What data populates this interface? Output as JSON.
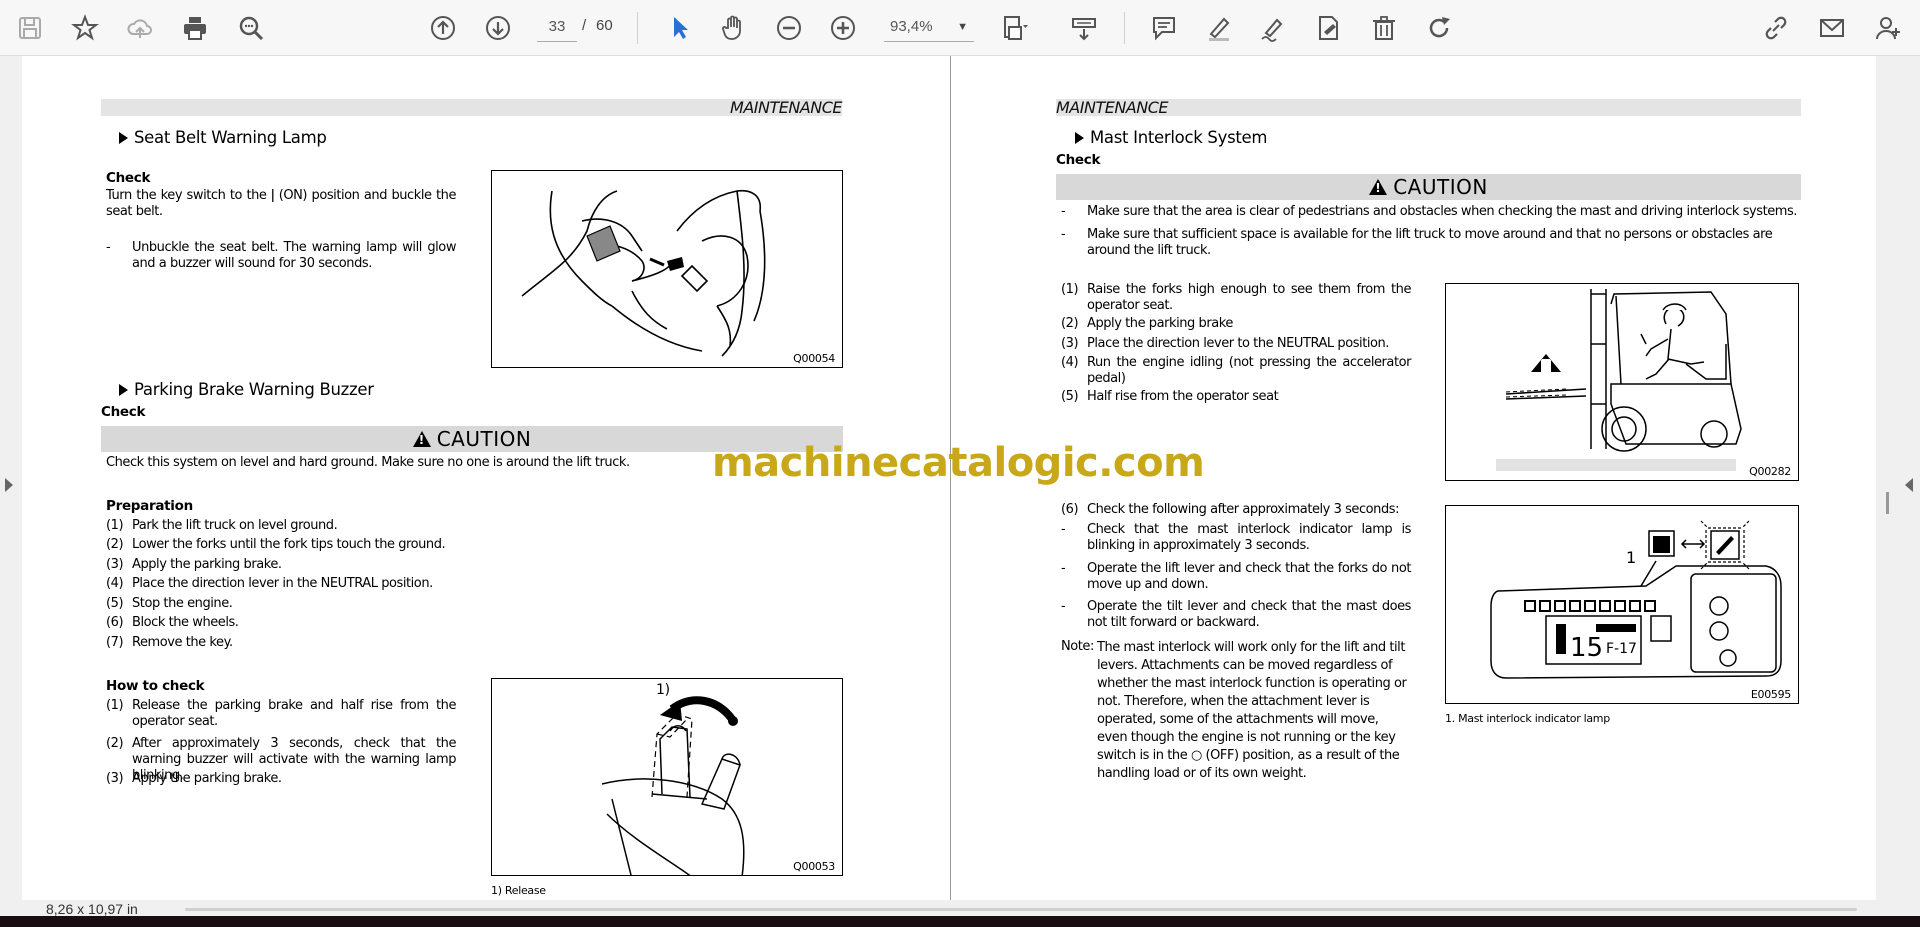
{
  "toolbar": {
    "page_current": "33",
    "page_separator": "/",
    "page_total": "60",
    "zoom_value": "93,4%",
    "icons": [
      "save-icon",
      "star-icon",
      "cloud-upload-icon",
      "print-icon",
      "zoom-search-icon",
      "page-up-icon",
      "page-down-icon",
      "select-cursor-icon",
      "hand-pan-icon",
      "zoom-out-icon",
      "zoom-in-icon",
      "fit-page-icon",
      "scroll-mode-icon",
      "comment-icon",
      "highlight-pen-icon",
      "sign-pen-icon",
      "stamp-icon",
      "delete-icon",
      "rotate-icon",
      "share-link-icon",
      "email-icon",
      "add-user-icon"
    ]
  },
  "status": {
    "page_size": "8,26 x 10,97 in"
  },
  "watermark": "machinecatalogic.com",
  "left_page": {
    "header": "MAINTENANCE",
    "seat_belt": {
      "title": "Seat Belt Warning Lamp",
      "check_label": "Check",
      "para": "Turn the key switch to the ǀ (ON) position and buckle the seat belt.",
      "bullet_dash": "-",
      "bullet": "Unbuckle the seat belt. The warning lamp will glow and a buzzer will sound for 30 seconds.",
      "fig_code": "Q00054"
    },
    "parking": {
      "title": "Parking Brake Warning Buzzer",
      "check_label": "Check",
      "caution_label": "CAUTION",
      "caution_text": "Check this system on level and hard ground. Make sure no one is around the lift truck.",
      "prep_label": "Preparation",
      "prep_steps": [
        {
          "n": "(1)",
          "t": "Park the lift truck on level ground."
        },
        {
          "n": "(2)",
          "t": "Lower the forks until the fork tips touch the ground."
        },
        {
          "n": "(3)",
          "t": "Apply the parking brake."
        },
        {
          "n": "(4)",
          "t": "Place the direction lever in the NEUTRAL position."
        },
        {
          "n": "(5)",
          "t": "Stop the engine."
        },
        {
          "n": "(6)",
          "t": "Block the wheels."
        },
        {
          "n": "(7)",
          "t": "Remove the key."
        }
      ],
      "how_label": "How to check",
      "how_steps": [
        {
          "n": "(1)",
          "t": "Release the parking brake and half rise from the operator seat."
        },
        {
          "n": "(2)",
          "t": "After approximately 3 seconds, check that the warning buzzer will activate with the warning lamp blinking."
        },
        {
          "n": "(3)",
          "t": "Apply the parking brake."
        }
      ],
      "fig_label": "1)",
      "fig_code": "Q00053",
      "fig_caption": "1) Release"
    }
  },
  "right_page": {
    "header": "MAINTENANCE",
    "title": "Mast Interlock System",
    "check_label": "Check",
    "caution_label": "CAUTION",
    "caution_bullets": [
      {
        "d": "-",
        "t": "Make sure that the area is clear of pedestrians and obstacles when checking the mast and driving interlock systems."
      },
      {
        "d": "-",
        "t": "Make sure that sufficient space is available for the lift truck to move around and that no persons or obstacles are around the lift truck."
      }
    ],
    "steps": [
      {
        "n": "(1)",
        "t": "Raise the forks high enough to see them from the operator seat."
      },
      {
        "n": "(2)",
        "t": "Apply the parking brake"
      },
      {
        "n": "(3)",
        "t": "Place the direction lever to the NEUTRAL position."
      },
      {
        "n": "(4)",
        "t": "Run the engine idling (not pressing the accelerator pedal)"
      },
      {
        "n": "(5)",
        "t": "Half rise from the operator seat"
      }
    ],
    "fig1_code": "Q00282",
    "step6": {
      "n": "(6)",
      "t": "Check the following after approximately 3 seconds:"
    },
    "checks": [
      {
        "d": "-",
        "t": "Check that the mast interlock indicator lamp is blinking in approximately 3 seconds."
      },
      {
        "d": "-",
        "t": "Operate the lift lever and check that the forks do not move up and down."
      },
      {
        "d": "-",
        "t": "Operate the tilt lever and check that the mast does not tilt forward or backward."
      }
    ],
    "note_label": "Note:",
    "note_text": "The mast interlock will work only for the lift and tilt levers. Attachments can be moved regardless of whether the mast interlock function is operating or not. Therefore, when the attachment lever is operated, some of the attachments will move, even though the engine is not running or the key switch is in the ○ (OFF) position, as a result of the handling load or of its own weight.",
    "fig2_label": "1",
    "fig2_code": "E00595",
    "fig2_caption": "1.  Mast interlock indicator lamp"
  }
}
